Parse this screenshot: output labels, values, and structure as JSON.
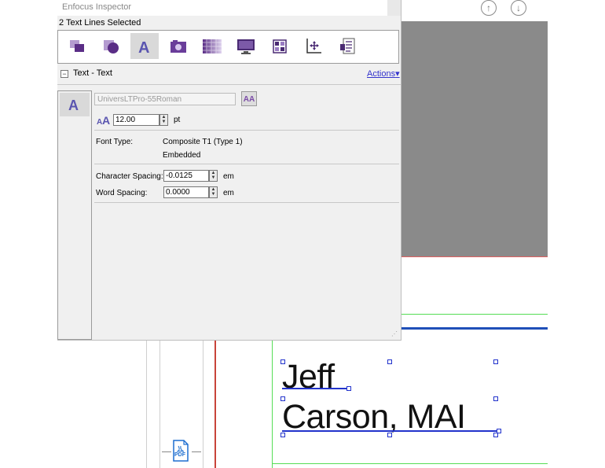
{
  "inspector": {
    "window_title": "Enfocus Inspector",
    "selection_status": "2 Text Lines Selected",
    "toolbar_icons": [
      "object-icon",
      "shape-icon",
      "text-icon",
      "image-icon",
      "pattern-icon",
      "monitor-icon",
      "layout-icon",
      "position-icon",
      "properties-icon"
    ],
    "section_title": "Text - Text",
    "actions_label": "Actions",
    "font_name": "UniversLTPro-55Roman",
    "font_size_value": "12.00",
    "font_size_unit": "pt",
    "font_type_label": "Font Type:",
    "font_type_value": "Composite T1 (Type 1)",
    "font_embedding": "Embedded",
    "char_spacing_label": "Character Spacing:",
    "char_spacing_value": "-0.0125",
    "char_spacing_unit": "em",
    "word_spacing_label": "Word Spacing:",
    "word_spacing_value": "0.0000",
    "word_spacing_unit": "em"
  },
  "document": {
    "text_line_1": "Jeff",
    "text_line_2": "Carson, MAI",
    "pdf_badge": "PDF"
  },
  "colors": {
    "accent_purple": "#6a3d9a",
    "selection_blue": "#2233cc",
    "link_blue": "#3333cc"
  }
}
